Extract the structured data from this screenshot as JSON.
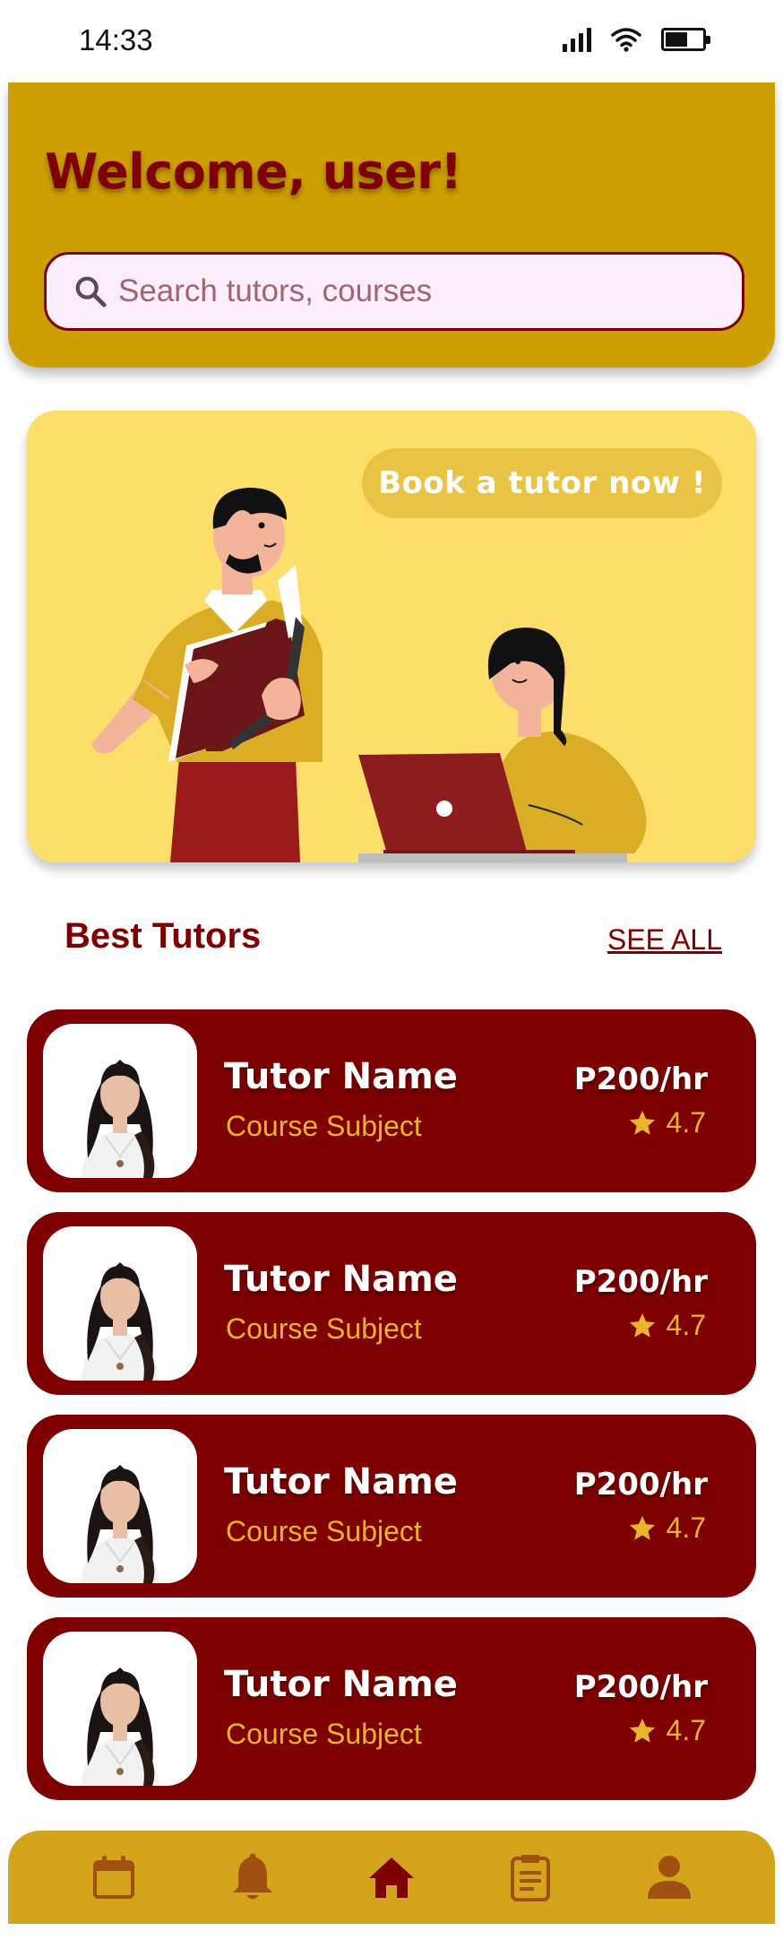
{
  "status_bar": {
    "time": "14:33",
    "icons": [
      "signal-icon",
      "wifi-icon",
      "battery-icon"
    ]
  },
  "header": {
    "welcome": "Welcome, user!",
    "search_placeholder": "Search tutors, courses"
  },
  "banner": {
    "cta_label": "Book a tutor now !"
  },
  "best_tutors": {
    "title": "Best Tutors",
    "see_all": "SEE ALL",
    "tutors": [
      {
        "name": "Tutor Name",
        "subject": "Course Subject",
        "rate": "P200/hr",
        "rating": "4.7"
      },
      {
        "name": "Tutor Name",
        "subject": "Course Subject",
        "rate": "P200/hr",
        "rating": "4.7"
      },
      {
        "name": "Tutor Name",
        "subject": "Course Subject",
        "rate": "P200/hr",
        "rating": "4.7"
      },
      {
        "name": "Tutor Name",
        "subject": "Course Subject",
        "rate": "P200/hr",
        "rating": "4.7"
      }
    ]
  },
  "bottom_nav": {
    "items": [
      "calendar-icon",
      "bell-icon",
      "home-icon",
      "clipboard-icon",
      "profile-icon"
    ],
    "active": "home-icon"
  },
  "colors": {
    "maroon": "#7E0000",
    "gold": "#CE9F00",
    "banner_yellow": "#FDDE6B",
    "accent_gold": "#E9B32A"
  }
}
